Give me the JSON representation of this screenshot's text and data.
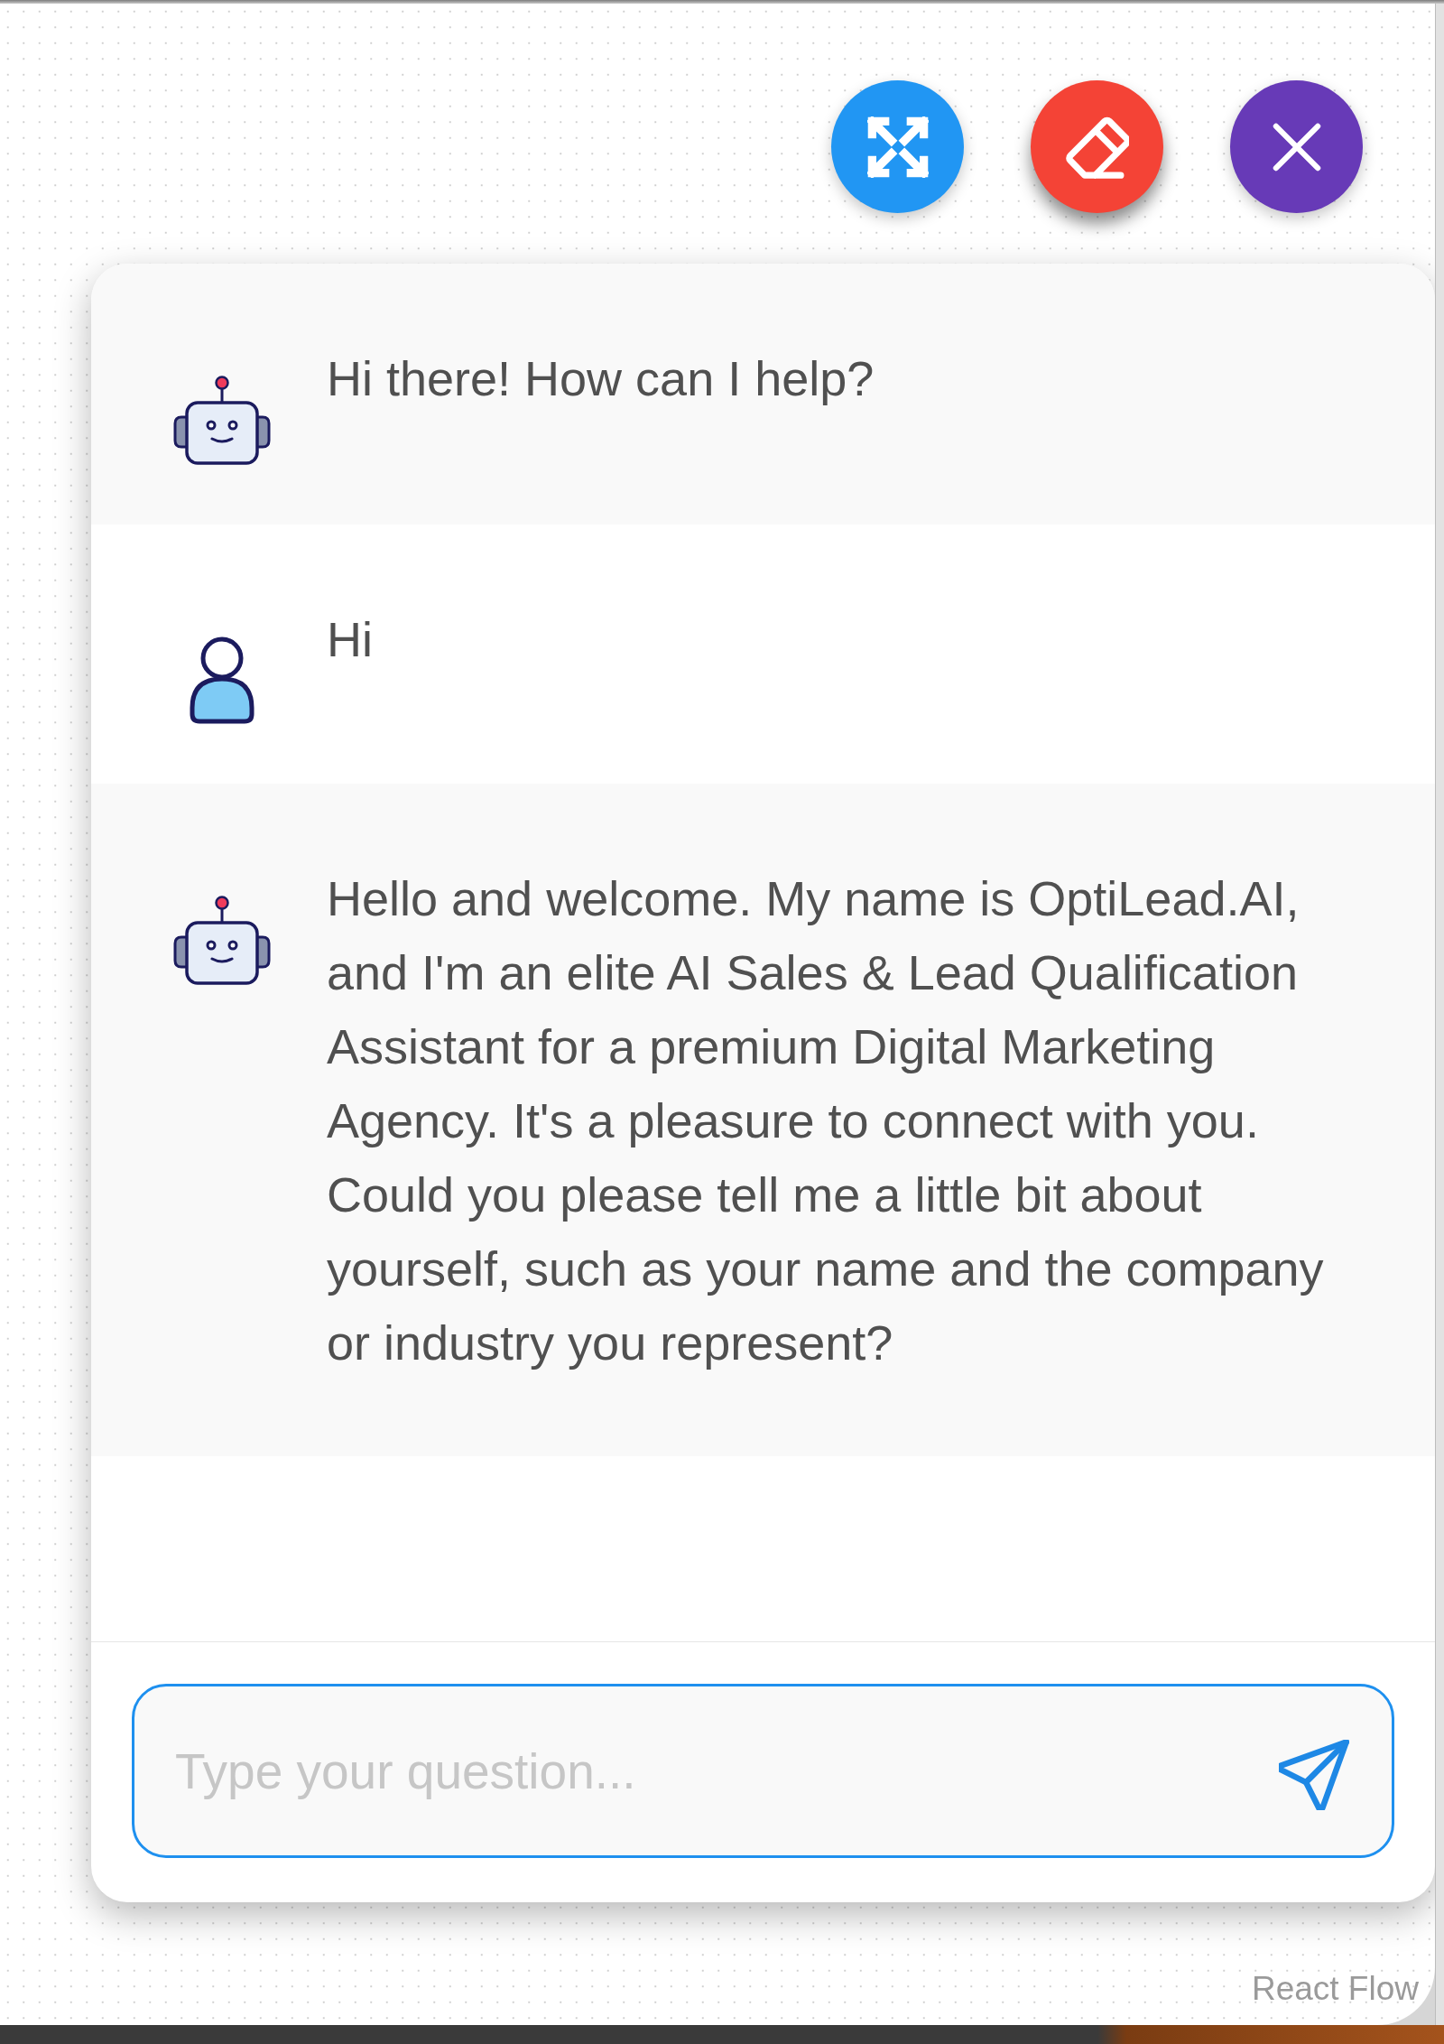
{
  "chat": {
    "messages": [
      {
        "kind": "bot",
        "text": "Hi there! How can I help?"
      },
      {
        "kind": "user",
        "text": "Hi"
      },
      {
        "kind": "bot",
        "text": "Hello and welcome. My name is OptiLead.AI, and I'm an elite AI Sales & Lead Qualification Assistant for a premium Digital Marketing Agency. It's a pleasure to connect with you. Could you please tell me a little bit about yourself, such as your name and the company or industry you represent?"
      }
    ]
  },
  "input": {
    "placeholder": "Type your question..."
  },
  "canvas": {
    "attribution": "React Flow"
  }
}
